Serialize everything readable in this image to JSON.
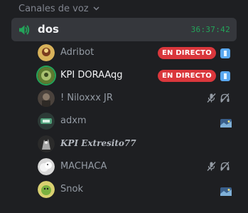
{
  "section": {
    "title": "Canales de voz"
  },
  "channel": {
    "name": "dos",
    "timer": "36:37:42"
  },
  "users": [
    {
      "name": "Adribot",
      "badge": "EN DIRECTO",
      "avatar_color": "#c9a24a"
    },
    {
      "name": "KPI DORAAqg",
      "badge": "EN DIRECTO",
      "avatar_color": "#6d8b3a"
    },
    {
      "name": "! Niloxxx JR",
      "avatar_color": "#5a5048"
    },
    {
      "name": "adxm",
      "avatar_color": "#3a7a5a"
    },
    {
      "name": "KPI Extresito77",
      "avatar_color": "#8a8a8a"
    },
    {
      "name": "MACHACA",
      "avatar_color": "#e0e0e0"
    },
    {
      "name": "Snok",
      "avatar_color": "#c8c060"
    }
  ],
  "colors": {
    "accent_green": "#23a55a",
    "live_red": "#da373c",
    "app_blue": "#5aa8f0"
  }
}
